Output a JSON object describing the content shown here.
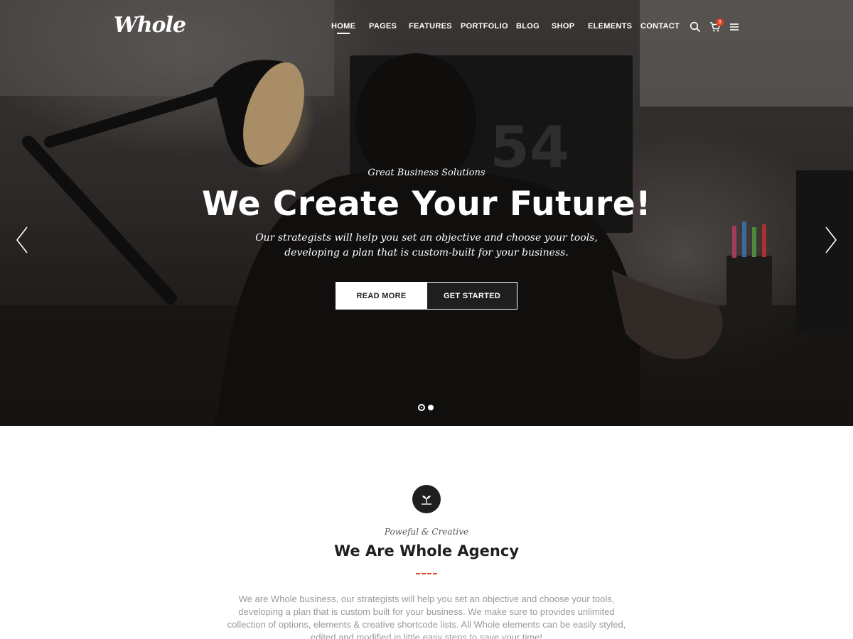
{
  "brand": {
    "logo_text": "Whole"
  },
  "nav": {
    "items": [
      {
        "label": "HOME",
        "active": true
      },
      {
        "label": "PAGES",
        "active": false
      },
      {
        "label": "FEATURES",
        "active": false
      },
      {
        "label": "PORTFOLIO",
        "active": false
      },
      {
        "label": "BLOG",
        "active": false
      },
      {
        "label": "SHOP",
        "active": false
      },
      {
        "label": "ELEMENTS",
        "active": false
      },
      {
        "label": "CONTACT",
        "active": false
      }
    ],
    "icons": [
      "search-icon",
      "cart-icon",
      "menu-icon"
    ],
    "cart_count": "3"
  },
  "hero": {
    "kicker": "Great Business Solutions",
    "title": "We Create Your Future!",
    "description": "Our strategists will help you set an objective and choose your tools, developing a plan that is custom-built for your business.",
    "primary_button": "READ MORE",
    "secondary_button": "GET STARTED",
    "slides": 2,
    "active_slide": 1
  },
  "about": {
    "icon": "sprout-icon",
    "kicker": "Poweful & Creative",
    "title": "We Are Whole Agency",
    "text": "We are Whole business, our strategists will help you set an objective and choose your tools, developing a plan that is custom built for your business. We make sure to provides unlimited collection of options, elements & creative shortcode lists. All Whole elements can be easily styled, edited and modified in little easy steps to save your time!"
  },
  "colors": {
    "accent": "#e0442a",
    "dark": "#1f1f1f",
    "muted_text": "#9a9a9a"
  }
}
